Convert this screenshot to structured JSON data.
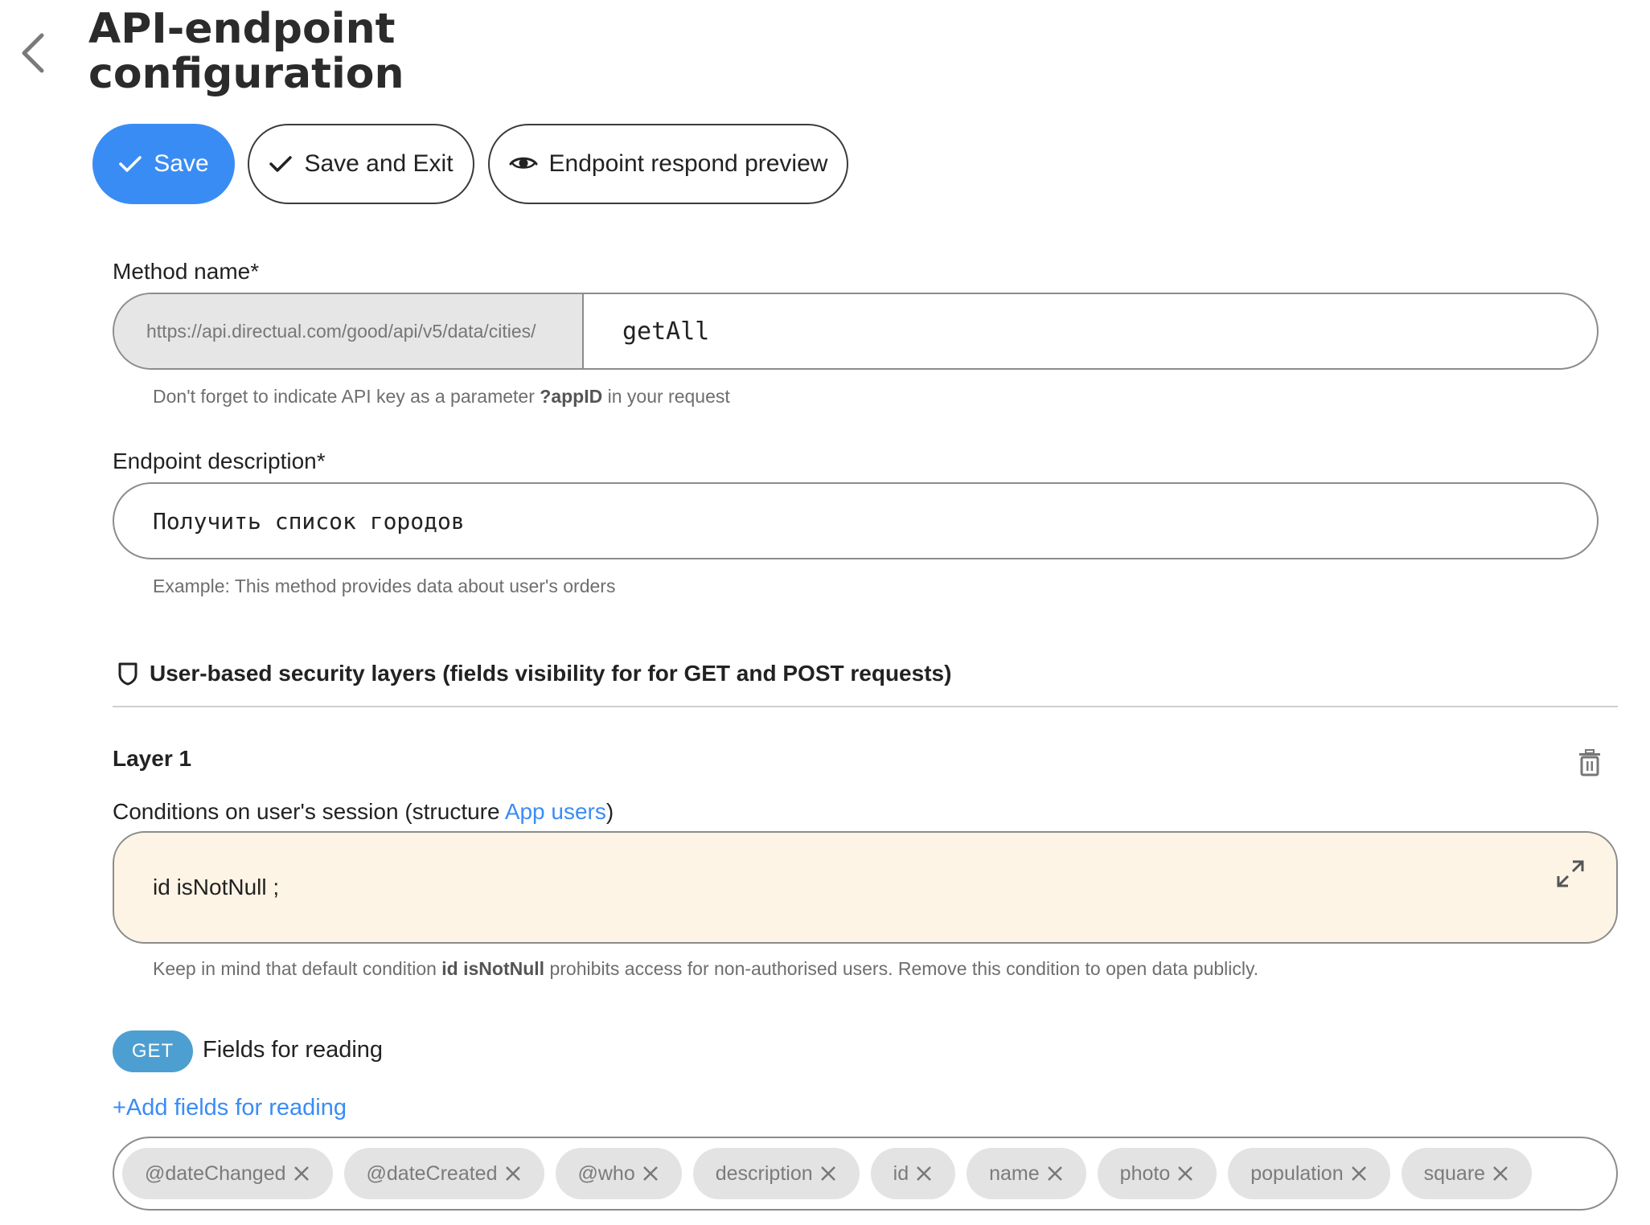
{
  "header": {
    "title_line1": "API-endpoint",
    "title_line2": "configuration",
    "back_icon": "chevron-left-icon"
  },
  "toolbar": {
    "save_label": "Save",
    "save_exit_label": "Save and Exit",
    "preview_label": "Endpoint respond preview",
    "save_color": "#3a8cf5"
  },
  "method": {
    "label": "Method name*",
    "prefix": "https://api.directual.com/good/api/v5/data/cities/",
    "value": "getAll",
    "hint_before": "Don't forget to indicate API key as a parameter ",
    "hint_bold": "?appID",
    "hint_after": " in your request"
  },
  "description": {
    "label": "Endpoint description*",
    "value": "Получить список городов",
    "hint": "Example: This method provides data about user's orders"
  },
  "security": {
    "heading": "User-based security layers (fields visibility for for GET and POST requests)",
    "icon": "shield-icon",
    "layer": {
      "title": "Layer 1",
      "conditions_label_before": "Conditions on user's session (structure ",
      "conditions_link": "App users",
      "conditions_label_after": ")",
      "condition_text": "id isNotNull ;",
      "condition_bg": "#fdf4e5",
      "hint_before": "Keep in mind that default condition ",
      "hint_bold": "id isNotNull",
      "hint_after": " prohibits access for non-authorised users. Remove this condition to open data publicly.",
      "get_badge": "GET",
      "get_badge_color": "#4d9fd1",
      "get_label": "Fields for reading",
      "add_fields_label": "+Add fields for reading",
      "fields": [
        "@dateChanged",
        "@dateCreated",
        "@who",
        "description",
        "id",
        "name",
        "photo",
        "population",
        "square"
      ]
    }
  }
}
